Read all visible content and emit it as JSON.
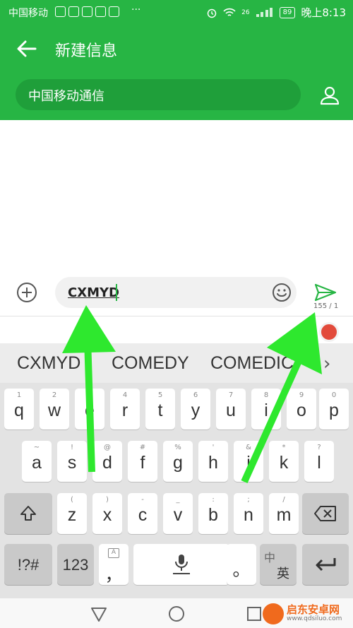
{
  "status_bar": {
    "carrier": "中国移动",
    "more": "···",
    "signal": "26",
    "battery": "89",
    "time": "晚上8:13"
  },
  "header": {
    "title": "新建信息",
    "recipient": "中国移动通信"
  },
  "compose": {
    "text": "CXMYD",
    "counter": "155 / 1"
  },
  "suggestions": [
    "CXMYD",
    "COMEDY",
    "COMEDIC"
  ],
  "keyboard": {
    "row1": [
      {
        "sub": "1",
        "main": "q"
      },
      {
        "sub": "2",
        "main": "w"
      },
      {
        "sub": "3",
        "main": "e"
      },
      {
        "sub": "4",
        "main": "r"
      },
      {
        "sub": "5",
        "main": "t"
      },
      {
        "sub": "6",
        "main": "y"
      },
      {
        "sub": "7",
        "main": "u"
      },
      {
        "sub": "8",
        "main": "i"
      },
      {
        "sub": "9",
        "main": "o"
      },
      {
        "sub": "0",
        "main": "p"
      }
    ],
    "row2": [
      {
        "sub": "~",
        "main": "a"
      },
      {
        "sub": "!",
        "main": "s"
      },
      {
        "sub": "@",
        "main": "d"
      },
      {
        "sub": "#",
        "main": "f"
      },
      {
        "sub": "%",
        "main": "g"
      },
      {
        "sub": "'",
        "main": "h"
      },
      {
        "sub": "&",
        "main": "j"
      },
      {
        "sub": "*",
        "main": "k"
      },
      {
        "sub": "?",
        "main": "l"
      }
    ],
    "row3": [
      {
        "sub": "(",
        "main": "z"
      },
      {
        "sub": ")",
        "main": "x"
      },
      {
        "sub": "-",
        "main": "c"
      },
      {
        "sub": "_",
        "main": "v"
      },
      {
        "sub": ":",
        "main": "b"
      },
      {
        "sub": ";",
        "main": "n"
      },
      {
        "sub": "/",
        "main": "m"
      }
    ],
    "symbols_label": "!?#",
    "numbers_label": "123",
    "comma_label": "，",
    "period_label": "。",
    "lang_top": "中",
    "lang_bottom": "英"
  },
  "watermark": {
    "title": "启东安卓网",
    "url": "www.qdsiluo.com"
  },
  "colors": {
    "brand_green": "#27b544",
    "pill_green": "#1f9f3a",
    "arrow_green": "#2ee82e"
  }
}
